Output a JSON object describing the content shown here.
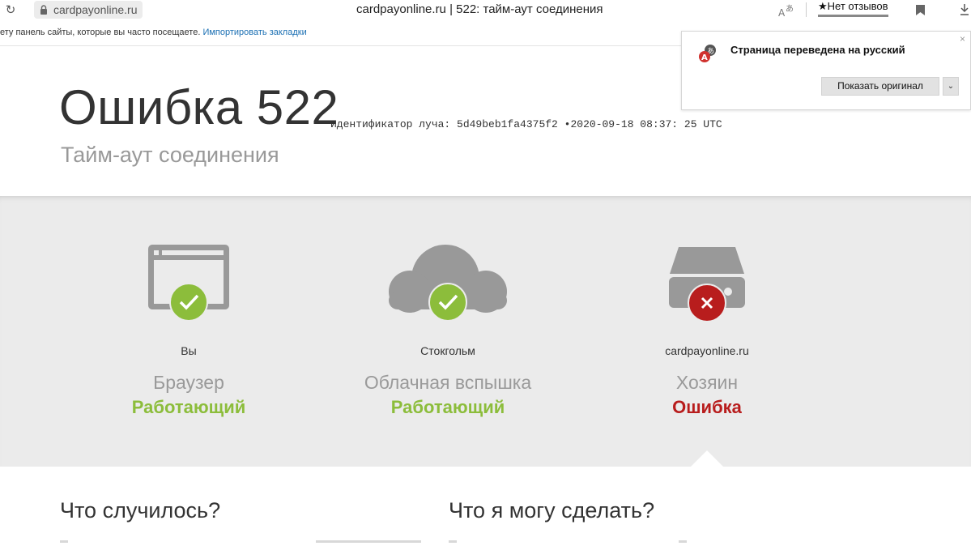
{
  "browser": {
    "url": "cardpayonline.ru",
    "tab_title": "cardpayonline.ru | 522: тайм-аут соединения",
    "reviews_label": "★Нет отзывов",
    "bookmarks_bar_text": "ету панель сайты, которые вы часто посещаете.",
    "bookmarks_bar_link": "Импортировать закладки",
    "icons": [
      "reload-icon",
      "lock-icon",
      "translate-icon",
      "bookmark-icon",
      "download-icon"
    ]
  },
  "translate_popup": {
    "title": "Страница переведена на русский",
    "show_original": "Показать оригинал",
    "close": "×",
    "dropdown": "⌄"
  },
  "error": {
    "title": "Ошибка 522",
    "ray_id": "Идентификатор луча: 5d49beb1fa4375f2",
    "separator": "•",
    "timestamp": "2020-09-18 08:37: 25 UTC",
    "subtitle": "Тайм-аут соединения"
  },
  "nodes": [
    {
      "location": "Вы",
      "role": "Браузер",
      "status": "Работающий",
      "state": "ok",
      "icon": "browser-window-icon"
    },
    {
      "location": "Стокгольм",
      "role": "Облачная вспышка",
      "status": "Работающий",
      "state": "ok",
      "icon": "cloud-icon"
    },
    {
      "location": "cardpayonline.ru",
      "role": "Хозяин",
      "status": "Ошибка",
      "state": "error",
      "icon": "server-drive-icon"
    }
  ],
  "sections": {
    "what_happened": "Что случилось?",
    "what_can_i_do": "Что я могу сделать?"
  },
  "colors": {
    "ok": "#8cbd3b",
    "error": "#b81d1d",
    "band_bg": "#ebebeb",
    "icon_gray": "#999999"
  }
}
